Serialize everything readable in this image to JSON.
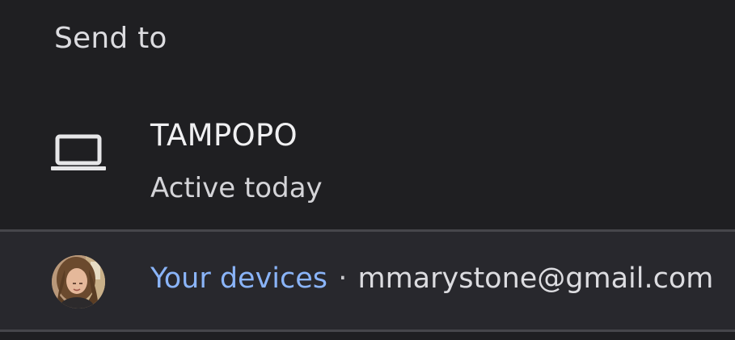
{
  "header": {
    "title": "Send to"
  },
  "device": {
    "name": "TAMPOPO",
    "status": "Active today",
    "icon": "laptop-icon"
  },
  "account": {
    "devices_link": "Your devices",
    "separator": "·",
    "email": "mmarystone@gmail.com",
    "avatar_icon": "user-avatar",
    "link_color": "#8ab4f8"
  },
  "colors": {
    "background": "#1f1f22",
    "account_bar": "#28282d",
    "divider": "#46464b"
  }
}
